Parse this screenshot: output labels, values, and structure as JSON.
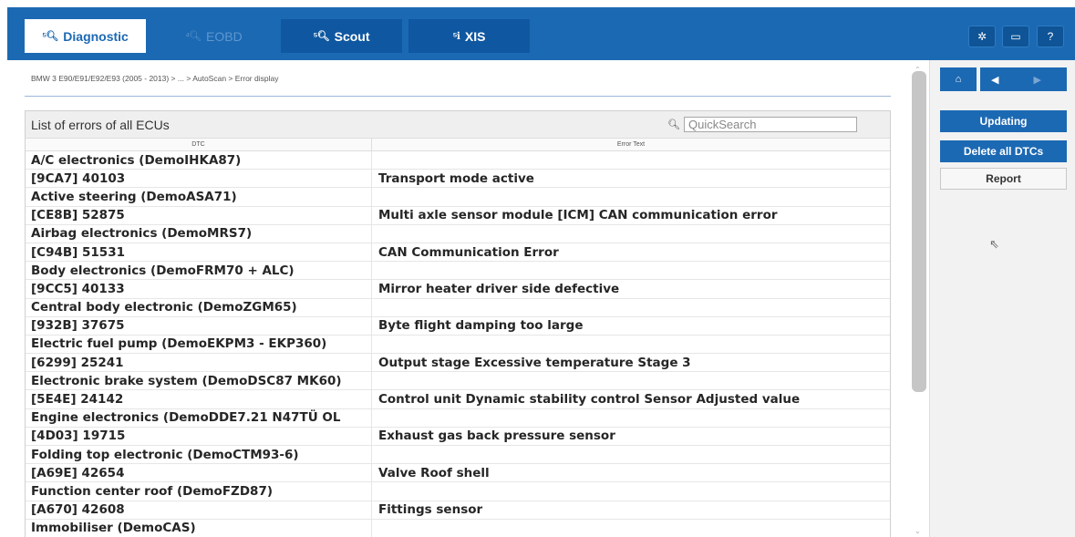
{
  "tabs": [
    {
      "label": "Diagnostic",
      "icon": "diagnostic-icon",
      "state": "active"
    },
    {
      "label": "EOBD",
      "icon": "eobd-icon",
      "state": "disabled"
    },
    {
      "label": "Scout",
      "icon": "scout-icon",
      "state": "normal"
    },
    {
      "label": "XIS",
      "icon": "xis-icon",
      "state": "normal"
    }
  ],
  "top_icons": [
    "settings-icon",
    "message-icon",
    "help-icon"
  ],
  "help_label": "?",
  "breadcrumb": "BMW 3 E90/E91/E92/E93 (2005 - 2013) > ... > AutoScan > Error display",
  "panel": {
    "title": "List of errors of all ECUs",
    "search_placeholder": "QuickSearch",
    "columns": [
      "DTC",
      "Error Text"
    ]
  },
  "rows": [
    {
      "dtc": "A/C electronics (DemoIHKA87)",
      "text": ""
    },
    {
      "dtc": "[9CA7] 40103",
      "text": "Transport mode active"
    },
    {
      "dtc": "Active steering (DemoASA71)",
      "text": ""
    },
    {
      "dtc": "[CE8B] 52875",
      "text": "Multi axle sensor module [ICM] CAN communication error"
    },
    {
      "dtc": "Airbag electronics (DemoMRS7)",
      "text": ""
    },
    {
      "dtc": "[C94B] 51531",
      "text": "CAN Communication Error"
    },
    {
      "dtc": "Body electronics (DemoFRM70 + ALC)",
      "text": ""
    },
    {
      "dtc": "[9CC5] 40133",
      "text": "Mirror heater driver side defective"
    },
    {
      "dtc": "Central body electronic (DemoZGM65)",
      "text": ""
    },
    {
      "dtc": "[932B] 37675",
      "text": "Byte flight damping too large"
    },
    {
      "dtc": "Electric fuel pump (DemoEKPM3 - EKP360)",
      "text": ""
    },
    {
      "dtc": "[6299] 25241",
      "text": "Output stage Excessive temperature Stage 3"
    },
    {
      "dtc": "Electronic brake system (DemoDSC87 MK60)",
      "text": ""
    },
    {
      "dtc": "[5E4E] 24142",
      "text": "Control unit Dynamic stability control Sensor Adjusted value"
    },
    {
      "dtc": "Engine electronics (DemoDDE7.21 N47TÜ OL",
      "text": ""
    },
    {
      "dtc": "[4D03] 19715",
      "text": "Exhaust gas back pressure sensor"
    },
    {
      "dtc": "Folding top electronic (DemoCTM93-6)",
      "text": ""
    },
    {
      "dtc": "[A69E] 42654",
      "text": "Valve Roof shell"
    },
    {
      "dtc": "Function center roof (DemoFZD87)",
      "text": ""
    },
    {
      "dtc": "[A670] 42608",
      "text": "Fittings sensor"
    },
    {
      "dtc": "Immobiliser (DemoCAS)",
      "text": ""
    }
  ],
  "nav_icons": [
    "home-icon",
    "back-icon",
    "forward-icon"
  ],
  "actions": {
    "updating": "Updating",
    "delete_all": "Delete all DTCs",
    "report": "Report"
  },
  "colors": {
    "brand_blue": "#1c69b3",
    "dark_blue": "#0f58a1"
  }
}
